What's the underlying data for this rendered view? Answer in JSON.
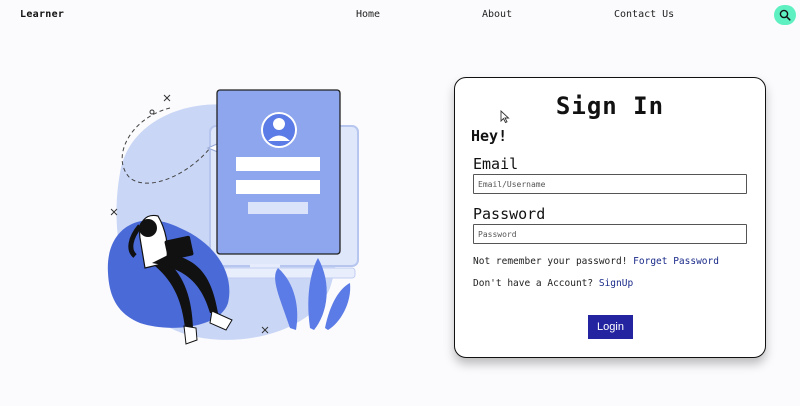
{
  "nav": {
    "brand": "Learner",
    "links": [
      "Home",
      "About",
      "Contact Us"
    ],
    "search_icon": "search-icon",
    "accent": "#5ff0c2"
  },
  "illustration": {
    "icon": "person-with-laptop-login-illustration",
    "primary": "#5b7be6",
    "light": "#c9d6f6"
  },
  "card": {
    "title": "Sign In",
    "greeting": "Hey!",
    "email_label": "Email",
    "email_placeholder": "Email/Username",
    "password_label": "Password",
    "password_placeholder": "Password",
    "forgot_text": "Not remember your password!",
    "forgot_link": "Forget Password",
    "signup_text": "Don't have a Account?",
    "signup_link": "SignUp",
    "login_label": "Login",
    "button_color": "#2424a0"
  }
}
